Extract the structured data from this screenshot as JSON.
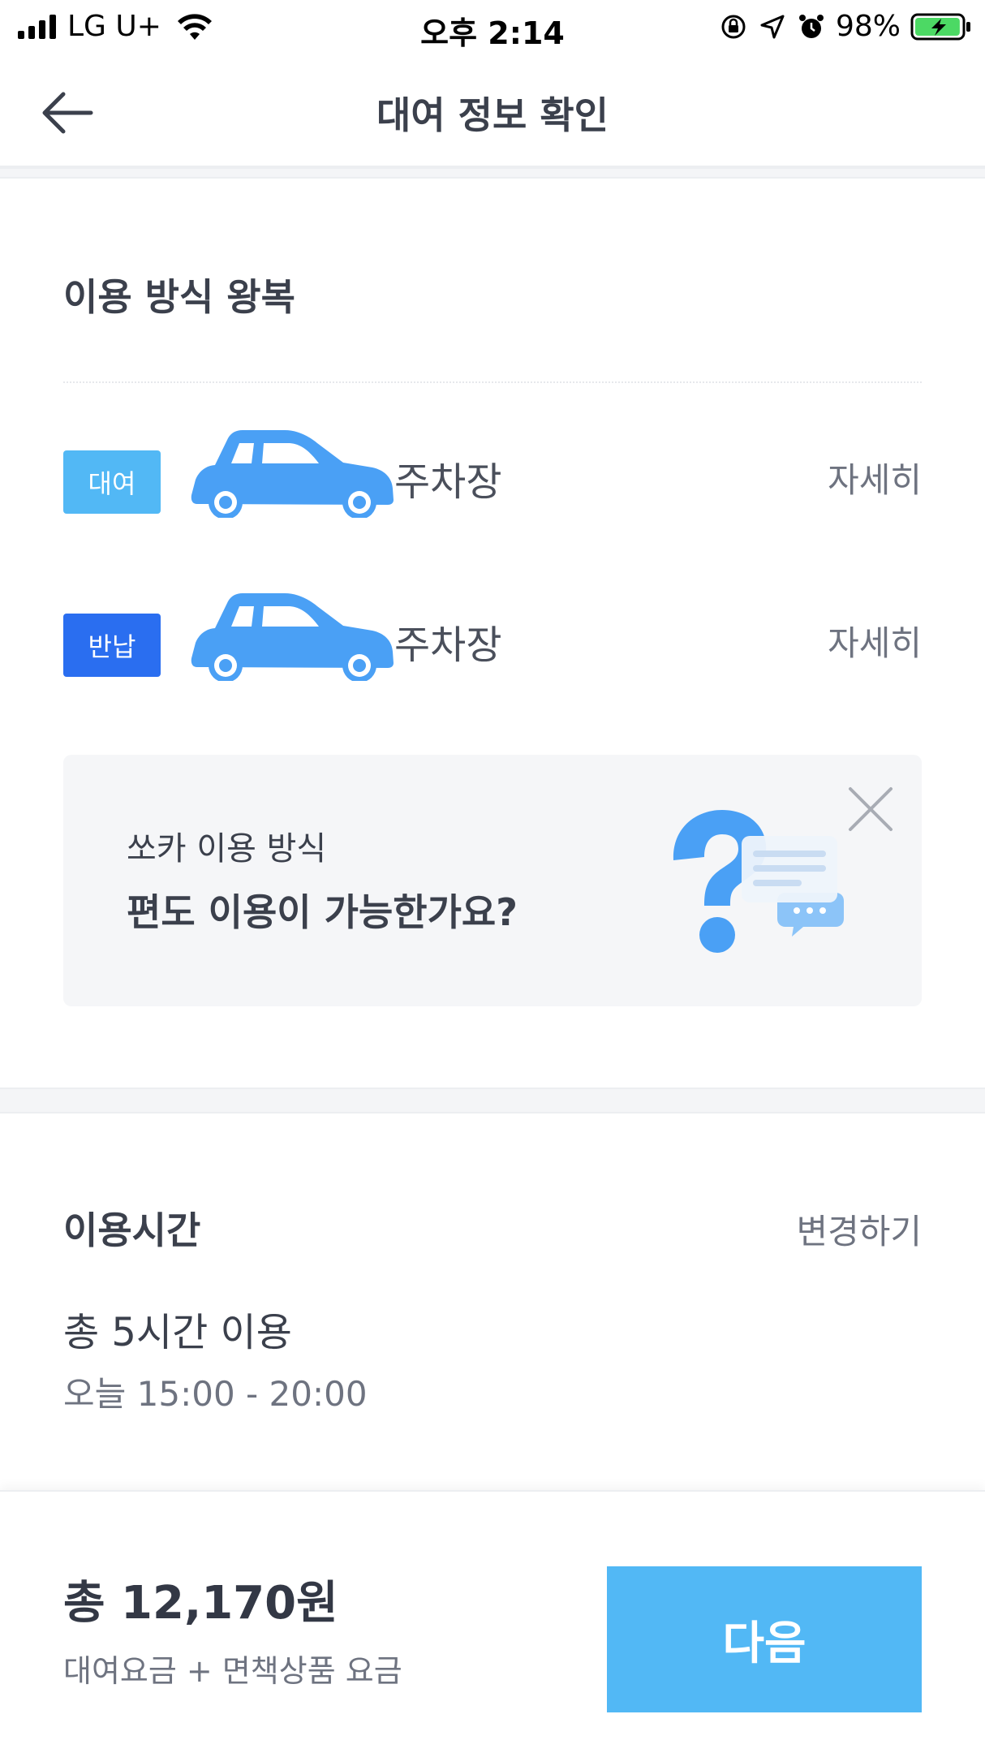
{
  "status_bar": {
    "carrier": "LG U+",
    "time": "오후 2:14",
    "battery_percent": "98%",
    "battery_level": 0.98,
    "icons": [
      "signal-icon",
      "wifi-icon",
      "orientation-lock-icon",
      "location-arrow-icon",
      "alarm-icon",
      "battery-charging-icon"
    ]
  },
  "header": {
    "title": "대여 정보 확인",
    "back_icon": "back-arrow-icon"
  },
  "usage_method": {
    "title": "이용 방식 왕복",
    "rows": [
      {
        "badge": "대여",
        "badge_color": "#52b8f5",
        "location": "주차장",
        "detail_label": "자세히"
      },
      {
        "badge": "반납",
        "badge_color": "#2a6ef0",
        "location": "주차장",
        "detail_label": "자세히"
      }
    ],
    "car_icon": "car-icon",
    "car_color": "#4aa0f5",
    "info_card": {
      "subtitle": "쏘카 이용 방식",
      "title": "편도 이용이 가능한가요?",
      "illustration": "question-chat-illustration",
      "close_icon": "close-icon"
    }
  },
  "usage_time": {
    "title": "이용시간",
    "change_label": "변경하기",
    "total": "총 5시간 이용",
    "range": "오늘 15:00 - 20:00"
  },
  "footer": {
    "total_price": "총 12,170원",
    "price_desc": "대여요금 + 면책상품 요금",
    "next_label": "다음",
    "accent": "#52b8f5"
  }
}
